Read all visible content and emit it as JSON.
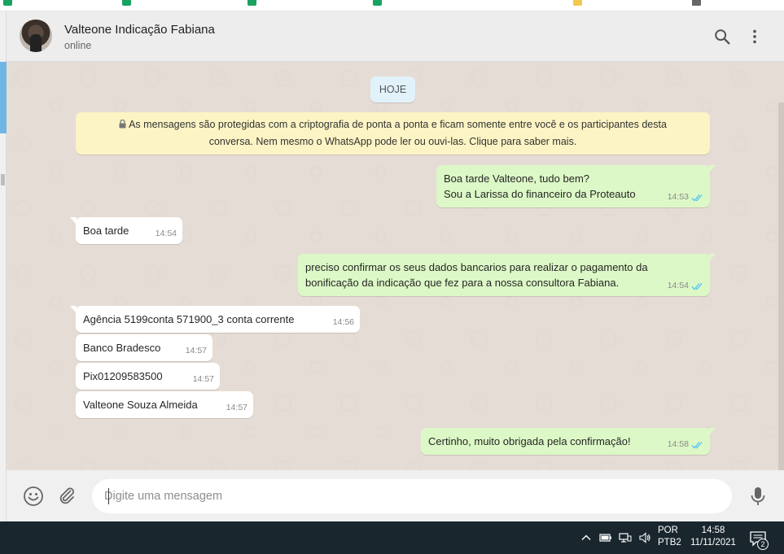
{
  "header": {
    "contact_name": "Valteone Indicação Fabiana",
    "status": "online"
  },
  "chat": {
    "day_label": "HOJE",
    "encryption_notice_line1": "As mensagens são protegidas com a criptografia de ponta a ponta e ficam somente entre você e os participantes desta",
    "encryption_notice_line2": "conversa. Nem mesmo o WhatsApp pode ler ou ouvi-las. Clique para saber mais.",
    "messages": [
      {
        "direction": "out",
        "lines": [
          "Boa tarde Valteone, tudo bem?",
          "Sou a Larissa do financeiro da Proteauto"
        ],
        "time": "14:53",
        "read": true
      },
      {
        "direction": "in",
        "lines": [
          "Boa tarde"
        ],
        "time": "14:54"
      },
      {
        "direction": "out",
        "lines": [
          "preciso confirmar os seus dados bancarios para realizar o pagamento da",
          "bonificação da indicação que fez para a nossa consultora Fabiana."
        ],
        "time": "14:54",
        "read": true
      },
      {
        "direction": "in",
        "lines": [
          "Agência 5199conta 571900_3 conta corrente"
        ],
        "time": "14:56"
      },
      {
        "direction": "in",
        "lines": [
          "Banco Bradesco"
        ],
        "time": "14:57"
      },
      {
        "direction": "in",
        "lines": [
          "Pix01209583500"
        ],
        "time": "14:57"
      },
      {
        "direction": "in",
        "lines": [
          "Valteone Souza Almeida"
        ],
        "time": "14:57"
      },
      {
        "direction": "out",
        "lines": [
          "Certinho, muito obrigada pela confirmação!"
        ],
        "time": "14:58",
        "read": true
      }
    ]
  },
  "composer": {
    "placeholder": "Digite uma mensagem"
  },
  "taskbar": {
    "lang_line1": "POR",
    "lang_line2": "PTB2",
    "time": "14:58",
    "date": "11/11/2021",
    "notification_count": "2"
  },
  "colors": {
    "outgoing_bubble": "#dcf8c6",
    "incoming_bubble": "#ffffff",
    "chat_background": "#e5ddd5",
    "read_ticks": "#4fc3f7",
    "notice_background": "#fcf4c4"
  }
}
